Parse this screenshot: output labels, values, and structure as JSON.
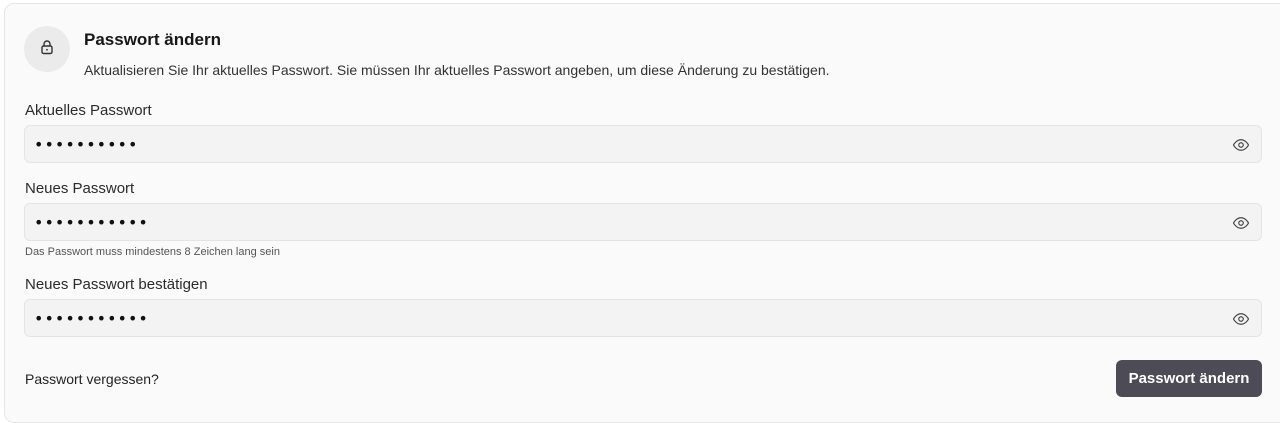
{
  "header": {
    "icon": "lock-icon",
    "title": "Passwort ändern",
    "description": "Aktualisieren Sie Ihr aktuelles Passwort. Sie müssen Ihr aktuelles Passwort angeben, um diese Änderung zu bestätigen."
  },
  "fields": {
    "current": {
      "label": "Aktuelles Passwort",
      "value": "••••••••••",
      "toggle_icon": "eye-icon"
    },
    "new": {
      "label": "Neues Passwort",
      "value": "•••••••••••",
      "hint": "Das Passwort muss mindestens 8 Zeichen lang sein",
      "toggle_icon": "eye-icon"
    },
    "confirm": {
      "label": "Neues Passwort bestätigen",
      "value": "•••••••••••",
      "toggle_icon": "eye-icon"
    }
  },
  "footer": {
    "forgot_label": "Passwort vergessen?",
    "submit_label": "Passwort ändern"
  },
  "colors": {
    "card_background": "#fafafa",
    "field_background": "#f3f3f3",
    "button_background": "#4d4b55",
    "button_text": "#ffffff"
  }
}
